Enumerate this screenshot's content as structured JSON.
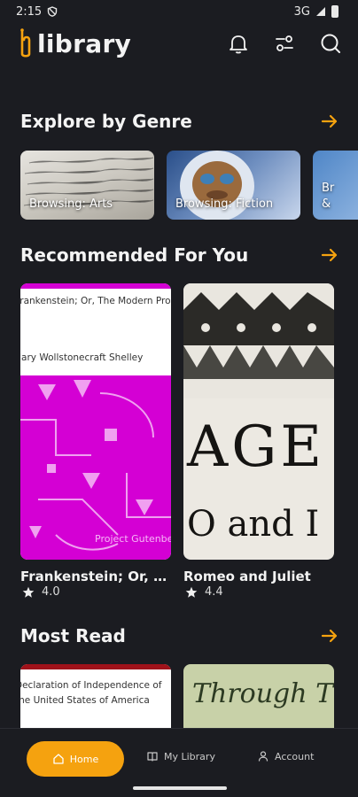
{
  "status": {
    "time": "2:15",
    "network": "3G"
  },
  "app": {
    "logo_text": "library"
  },
  "sections": {
    "explore": {
      "title": "Explore by Genre"
    },
    "recommended": {
      "title": "Recommended For You"
    },
    "most_read": {
      "title": "Most Read"
    }
  },
  "genres": [
    {
      "label": "Browsing: Arts"
    },
    {
      "label": "Browsing: Fiction"
    },
    {
      "label": "Br &"
    }
  ],
  "recommended": [
    {
      "title": "Frankenstein; Or, Th…",
      "rating": "4.0",
      "cover_title": "Frankenstein; Or, The Modern Prometheus",
      "cover_author": "Mary Wollstonecraft Shelley",
      "cover_publisher": "Project Gutenberg"
    },
    {
      "title": "Romeo and Juliet",
      "rating": "4.4",
      "cover_line1": "AGE",
      "cover_line2": "O and I"
    }
  ],
  "most_read": [
    {
      "cover_text": "Declaration of Independence of the United States of America"
    },
    {
      "cover_text": "Through The"
    }
  ],
  "nav": {
    "home": "Home",
    "my_library": "My Library",
    "account": "Account"
  },
  "colors": {
    "accent": "#f5a20f",
    "background": "#1b1c21",
    "magenta": "#d400d4"
  },
  "icons": [
    "bell-icon",
    "filter-icon",
    "search-icon",
    "arrow-right-icon",
    "star-icon",
    "home-icon",
    "book-icon",
    "person-icon"
  ]
}
